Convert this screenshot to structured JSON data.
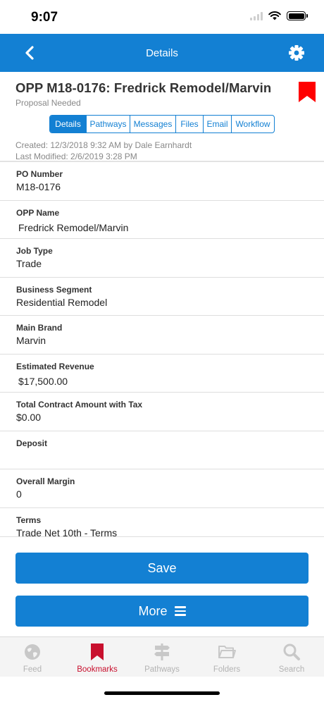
{
  "status_bar": {
    "time": "9:07"
  },
  "nav": {
    "title": "Details"
  },
  "header": {
    "title": "OPP M18-0176: Fredrick Remodel/Marvin",
    "subtitle": "Proposal Needed",
    "created": "Created: 12/3/2018 9:32 AM by Dale Earnhardt",
    "modified": "Last Modified: 2/6/2019 3:28 PM"
  },
  "tabs": [
    {
      "label": "Details",
      "active": true
    },
    {
      "label": "Pathways",
      "active": false
    },
    {
      "label": "Messages",
      "active": false
    },
    {
      "label": "Files",
      "active": false
    },
    {
      "label": "Email",
      "active": false
    },
    {
      "label": "Workflow",
      "active": false
    }
  ],
  "fields": [
    {
      "label": "PO Number",
      "value": "M18-0176"
    },
    {
      "label": "OPP Name",
      "value": "Fredrick Remodel/Marvin"
    },
    {
      "label": "Job Type",
      "value": "Trade"
    },
    {
      "label": "Business Segment",
      "value": "Residential Remodel"
    },
    {
      "label": "Main Brand",
      "value": "Marvin"
    },
    {
      "label": "Estimated Revenue",
      "value": "$17,500.00"
    },
    {
      "label": "Total Contract Amount with Tax",
      "value": "$0.00"
    },
    {
      "label": "Deposit",
      "value": ""
    },
    {
      "label": "Overall Margin",
      "value": "0"
    },
    {
      "label": "Terms",
      "value": "Trade Net 10th - Terms"
    }
  ],
  "buttons": {
    "save": "Save",
    "more": "More"
  },
  "tab_bar": [
    {
      "label": "Feed",
      "icon": "globe-icon",
      "active": false
    },
    {
      "label": "Bookmarks",
      "icon": "bookmark-icon",
      "active": true
    },
    {
      "label": "Pathways",
      "icon": "signpost-icon",
      "active": false
    },
    {
      "label": "Folders",
      "icon": "folder-icon",
      "active": false
    },
    {
      "label": "Search",
      "icon": "search-icon",
      "active": false
    }
  ],
  "colors": {
    "primary": "#1380d3",
    "bookmark": "#ff0000",
    "active_tab_label": "#c8102e",
    "inactive_tab": "#b3b3b3"
  }
}
